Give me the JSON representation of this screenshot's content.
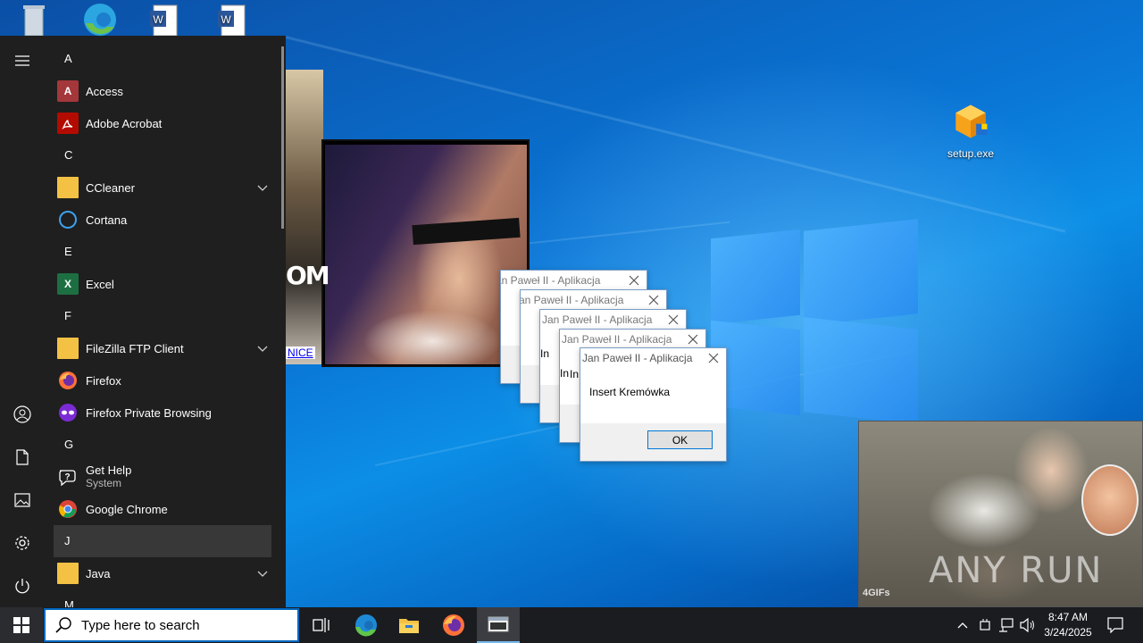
{
  "desktop": {
    "icons": [
      {
        "id": "recycle-bin",
        "label": ""
      },
      {
        "id": "edge",
        "label": ""
      },
      {
        "id": "word-doc-1",
        "label": ""
      },
      {
        "id": "word-doc-2",
        "label": ""
      },
      {
        "id": "setup",
        "label": "setup.exe"
      }
    ]
  },
  "start_menu": {
    "groups": [
      {
        "letter": "A",
        "apps": [
          {
            "name": "Access",
            "icon": "access-icon",
            "color": "#a4373a"
          },
          {
            "name": "Adobe Acrobat",
            "icon": "acrobat-icon",
            "color": "#b30b00"
          }
        ]
      },
      {
        "letter": "C",
        "apps": [
          {
            "name": "CCleaner",
            "icon": "folder-icon",
            "expandable": true
          },
          {
            "name": "Cortana",
            "icon": "cortana-icon"
          }
        ]
      },
      {
        "letter": "E",
        "apps": [
          {
            "name": "Excel",
            "icon": "excel-icon",
            "color": "#1d6f42"
          }
        ]
      },
      {
        "letter": "F",
        "apps": [
          {
            "name": "FileZilla FTP Client",
            "icon": "folder-icon",
            "expandable": true
          },
          {
            "name": "Firefox",
            "icon": "firefox-icon"
          },
          {
            "name": "Firefox Private Browsing",
            "icon": "firefox-private-icon"
          }
        ]
      },
      {
        "letter": "G",
        "apps": [
          {
            "name": "Get Help",
            "sub": "System",
            "icon": "get-help-icon"
          },
          {
            "name": "Google Chrome",
            "icon": "chrome-icon"
          }
        ]
      },
      {
        "letter": "J",
        "apps": [
          {
            "name": "Java",
            "icon": "folder-icon",
            "expandable": true
          }
        ]
      },
      {
        "letter": "M",
        "apps": []
      }
    ]
  },
  "popups": {
    "overlay_text": "OM",
    "link_text": "NICE",
    "gif_watermark": "ANY RUN",
    "gif_tag": "4GIFs"
  },
  "message_boxes": [
    {
      "title": "Jan Paweł II - Aplikacja",
      "body": "",
      "ok": ""
    },
    {
      "title": "Jan Paweł II - Aplikacja",
      "body": "",
      "ok": ""
    },
    {
      "title": "Jan Paweł II - Aplikacja",
      "body": "In",
      "ok": ""
    },
    {
      "title": "Jan Paweł II - Aplikacja",
      "body": "In",
      "ok": ""
    },
    {
      "title": "Jan Paweł II - Aplikacja",
      "body": "In",
      "ok": ""
    },
    {
      "title": "Jan Paweł II - Aplikacja",
      "body": "Insert Kremówka",
      "ok": "OK"
    }
  ],
  "taskbar": {
    "search_placeholder": "Type here to search",
    "time": "8:47 AM",
    "date": "3/24/2025"
  }
}
